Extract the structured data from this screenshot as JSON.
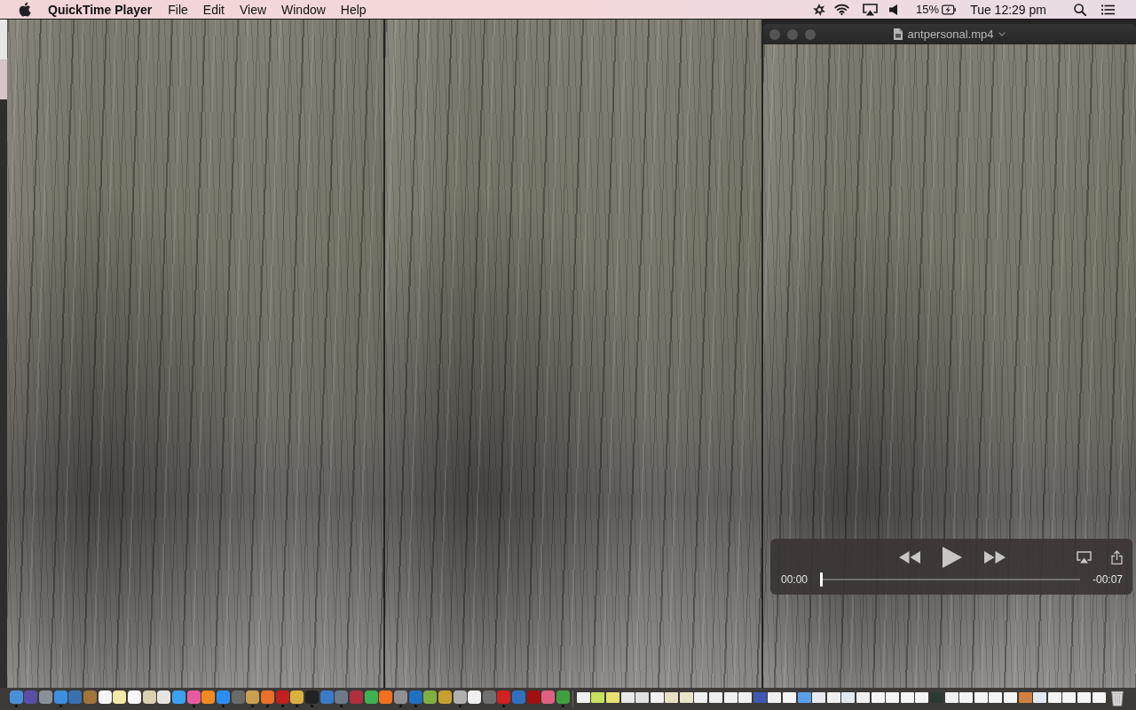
{
  "menu_bar": {
    "app_name": "QuickTime Player",
    "menus": [
      "File",
      "Edit",
      "View",
      "Window",
      "Help"
    ],
    "battery": "15%",
    "clock": "Tue 12:29 pm"
  },
  "player": {
    "title": "antpersonal.mp4",
    "elapsed": "00:00",
    "remaining": "-00:07",
    "level": 0
  },
  "dock": {
    "apps": [
      {
        "color": "#4a90d9",
        "running": true
      },
      {
        "color": "#5a4fa8",
        "running": false
      },
      {
        "color": "#8a8f99",
        "running": false
      },
      {
        "color": "#3d8fe0",
        "running": true
      },
      {
        "color": "#3a6fb0",
        "running": false
      },
      {
        "color": "#a0743a",
        "running": false
      },
      {
        "color": "#f5f5f5",
        "running": false
      },
      {
        "color": "#f3e9a8",
        "running": false
      },
      {
        "color": "#f7f7f7",
        "running": false
      },
      {
        "color": "#d9d0b0",
        "running": false
      },
      {
        "color": "#e8e4e0",
        "running": false
      },
      {
        "color": "#3aa0f0",
        "running": false
      },
      {
        "color": "#e85aa0",
        "running": true
      },
      {
        "color": "#f08a20",
        "running": false
      },
      {
        "color": "#2a8ef0",
        "running": true
      },
      {
        "color": "#6a6a6a",
        "running": false
      },
      {
        "color": "#c8a050",
        "running": true
      },
      {
        "color": "#e8702a",
        "running": true
      },
      {
        "color": "#c02020",
        "running": true
      },
      {
        "color": "#d8b040",
        "running": true
      },
      {
        "color": "#222222",
        "running": true
      },
      {
        "color": "#3a7ac8",
        "running": false
      },
      {
        "color": "#6a7a8a",
        "running": true
      },
      {
        "color": "#b03040",
        "running": false
      },
      {
        "color": "#40b050",
        "running": false
      },
      {
        "color": "#f07020",
        "running": false
      },
      {
        "color": "#909090",
        "running": true
      },
      {
        "color": "#2070c0",
        "running": true
      },
      {
        "color": "#80b040",
        "running": false
      },
      {
        "color": "#c8a030",
        "running": false
      },
      {
        "color": "#b0b0b0",
        "running": true
      },
      {
        "color": "#f0f0f0",
        "running": false
      },
      {
        "color": "#707070",
        "running": false
      },
      {
        "color": "#d02020",
        "running": true
      },
      {
        "color": "#3070c0",
        "running": false
      },
      {
        "color": "#a01010",
        "running": false
      },
      {
        "color": "#e06080",
        "running": false
      },
      {
        "color": "#40a040",
        "running": true
      }
    ],
    "documents": [
      {
        "color": "#f0f0f0"
      },
      {
        "color": "#c8e060"
      },
      {
        "color": "#e8e070"
      },
      {
        "color": "#e8e8e8"
      },
      {
        "color": "#e0e0e0"
      },
      {
        "color": "#f0f0f0"
      },
      {
        "color": "#e8e0c0"
      },
      {
        "color": "#e8e4c8"
      },
      {
        "color": "#f0f0f0"
      },
      {
        "color": "#eeeeee"
      },
      {
        "color": "#f0f0f0"
      },
      {
        "color": "#f0f0f0"
      },
      {
        "color": "#4058b0"
      },
      {
        "color": "#f0f0f0"
      },
      {
        "color": "#f4f4f4"
      },
      {
        "color": "#5aa0e8"
      },
      {
        "color": "#e8e8f0"
      },
      {
        "color": "#f0f0f0"
      },
      {
        "color": "#e0e8f0"
      },
      {
        "color": "#f0f0f0"
      },
      {
        "color": "#f4f4f4"
      },
      {
        "color": "#f4f4f4"
      },
      {
        "color": "#f4f4f4"
      },
      {
        "color": "#f4f4f4"
      },
      {
        "color": "#2a3a30"
      },
      {
        "color": "#f0f0f0"
      },
      {
        "color": "#f4f4f4"
      },
      {
        "color": "#f4f4f4"
      },
      {
        "color": "#f4f4f4"
      },
      {
        "color": "#f4f4f4"
      },
      {
        "color": "#d08040"
      },
      {
        "color": "#e0e8f0"
      },
      {
        "color": "#f4f4f4"
      },
      {
        "color": "#f4f4f4"
      },
      {
        "color": "#f4f4f4"
      },
      {
        "color": "#f4f4f4"
      }
    ]
  }
}
